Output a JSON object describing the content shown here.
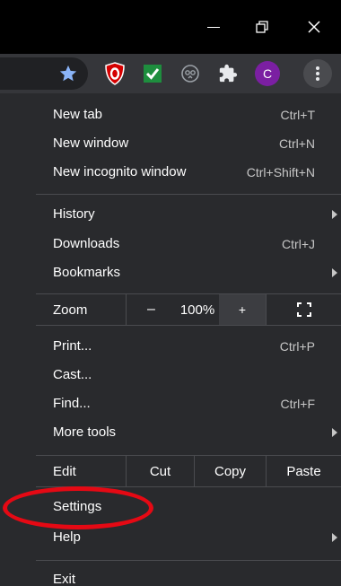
{
  "window_controls": {
    "minimize": "–",
    "maximize": "❐",
    "close": "✕"
  },
  "toolbar": {
    "profile_initial": "C",
    "icons": [
      "star-icon",
      "ublock-origin-icon",
      "checkmark-extension-icon",
      "owl-extension-icon",
      "puzzle-extensions-icon",
      "kebab-menu-icon"
    ],
    "colors": {
      "star": "#8ab4f8",
      "ublock": "#d50000",
      "check": "#1e8e3e",
      "avatar": "#7b1fa2"
    }
  },
  "menu": {
    "new_tab": {
      "label": "New tab",
      "shortcut": "Ctrl+T"
    },
    "new_window": {
      "label": "New window",
      "shortcut": "Ctrl+N"
    },
    "new_incognito": {
      "label": "New incognito window",
      "shortcut": "Ctrl+Shift+N"
    },
    "history": {
      "label": "History"
    },
    "downloads": {
      "label": "Downloads",
      "shortcut": "Ctrl+J"
    },
    "bookmarks": {
      "label": "Bookmarks"
    },
    "zoom": {
      "label": "Zoom",
      "minus": "–",
      "value": "100%",
      "plus": "+"
    },
    "print": {
      "label": "Print...",
      "shortcut": "Ctrl+P"
    },
    "cast": {
      "label": "Cast..."
    },
    "find": {
      "label": "Find...",
      "shortcut": "Ctrl+F"
    },
    "more_tools": {
      "label": "More tools"
    },
    "edit": {
      "label": "Edit",
      "cut": "Cut",
      "copy": "Copy",
      "paste": "Paste"
    },
    "settings": {
      "label": "Settings"
    },
    "help": {
      "label": "Help"
    },
    "exit": {
      "label": "Exit"
    }
  },
  "annotation_color": "#e50914"
}
